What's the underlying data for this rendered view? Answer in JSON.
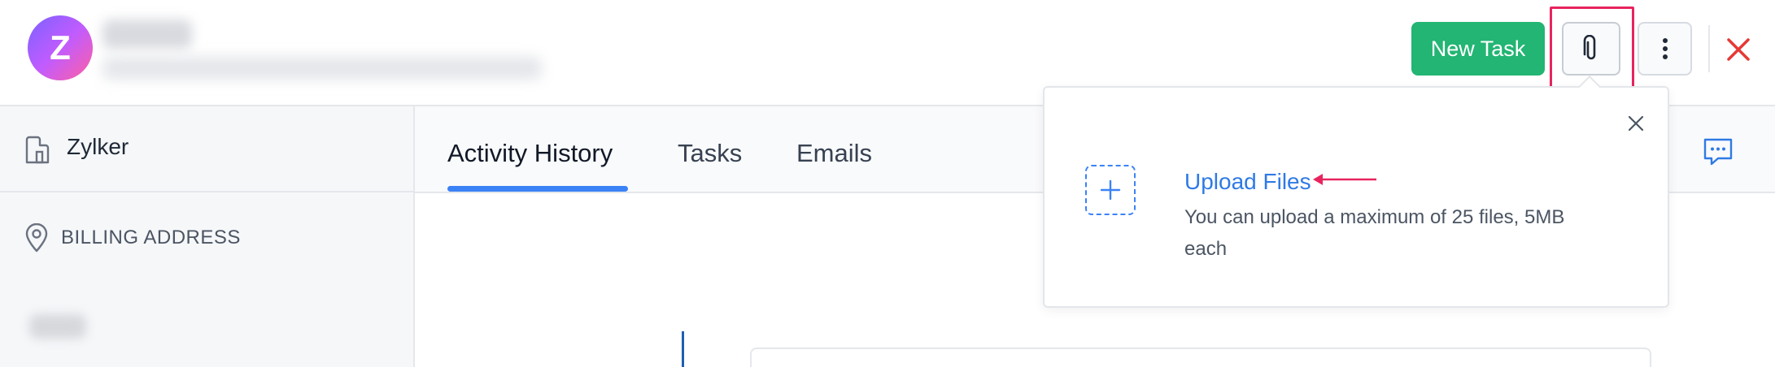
{
  "header": {
    "avatar_letter": "Z",
    "new_task_label": "New Task",
    "attach_icon": "paperclip-icon",
    "more_icon": "vertical-dots-icon",
    "close_icon": "close-icon"
  },
  "sidebar": {
    "org_icon": "building-icon",
    "org_name": "Zylker",
    "billing_icon": "location-pin-icon",
    "billing_label": "BILLING ADDRESS"
  },
  "tabs": [
    {
      "label": "Activity History",
      "active": true
    },
    {
      "label": "Tasks",
      "active": false
    },
    {
      "label": "Emails",
      "active": false
    }
  ],
  "popover": {
    "close_icon": "close-icon",
    "add_icon": "plus-icon",
    "title": "Upload Files",
    "description": "You can upload a maximum of 25 files, 5MB each"
  },
  "colors": {
    "accent_green": "#22b573",
    "accent_blue": "#3b82f6",
    "link_blue": "#2f7ae5",
    "highlight_pink": "#e8245f",
    "close_red": "#e53935"
  }
}
